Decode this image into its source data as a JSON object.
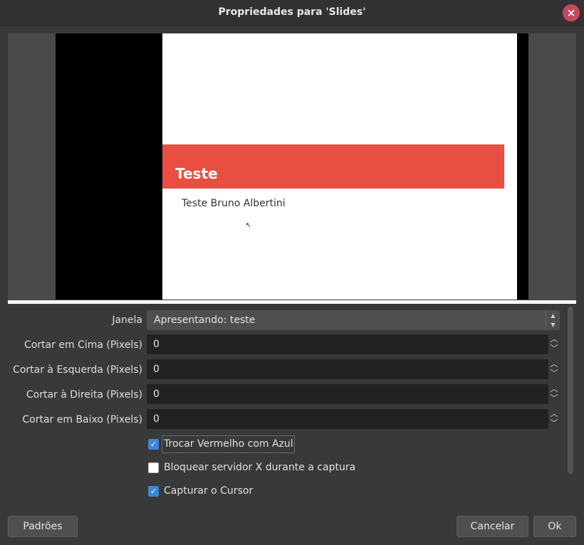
{
  "window": {
    "title": "Propriedades para 'Slides'",
    "close_icon": "×"
  },
  "preview": {
    "slide_title": "Teste",
    "slide_subtitle": "Teste Bruno Albertini",
    "accent_color": "#e84f40"
  },
  "form": {
    "window_label": "Janela",
    "window_value": "Apresentando: teste",
    "crop_top_label": "Cortar em Cima (Pixels)",
    "crop_top_value": "0",
    "crop_left_label": "Cortar à Esquerda (Pixels)",
    "crop_left_value": "0",
    "crop_right_label": "Cortar à Direita (Pixels)",
    "crop_right_value": "0",
    "crop_bottom_label": "Cortar em Baixo (Pixels)",
    "crop_bottom_value": "0",
    "checkboxes": [
      {
        "label": "Trocar Vermelho com Azul",
        "checked": true
      },
      {
        "label": "Bloquear servidor X durante a captura",
        "checked": false
      },
      {
        "label": "Capturar o Cursor",
        "checked": true
      }
    ]
  },
  "footer": {
    "defaults_label": "Padrões",
    "cancel_label": "Cancelar",
    "ok_label": "Ok"
  }
}
